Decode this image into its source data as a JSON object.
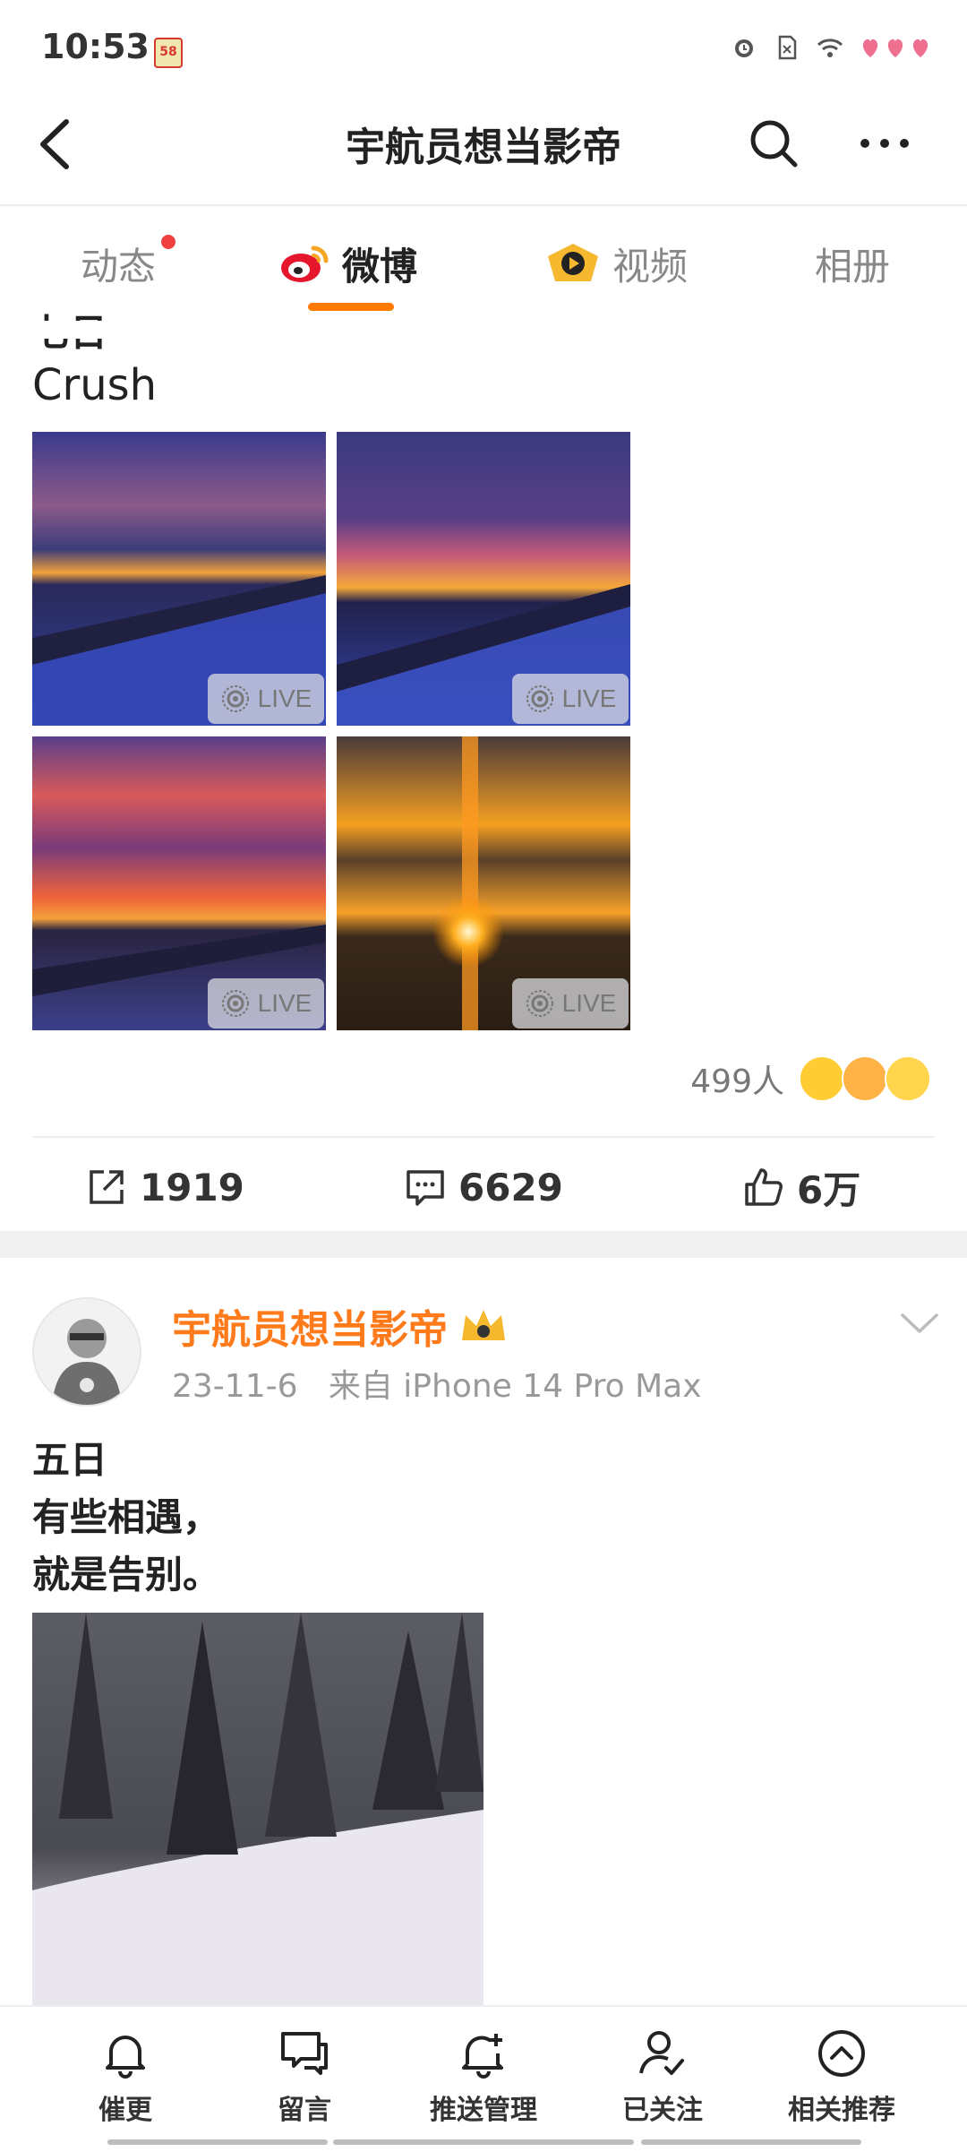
{
  "status": {
    "time": "10:53",
    "badge_text": "58",
    "icons": [
      "alarm-icon",
      "sim-icon",
      "wifi-icon",
      "hearts-icon"
    ]
  },
  "nav": {
    "title": "宇航员想当影帝",
    "back_icon": "back-icon",
    "search_icon": "search-icon",
    "more_icon": "more-icon"
  },
  "tabs": [
    {
      "label": "动态",
      "active": false,
      "has_dot": true
    },
    {
      "label": "微博",
      "active": true
    },
    {
      "label": "视频",
      "active": false
    },
    {
      "label": "相册",
      "active": false
    }
  ],
  "post1": {
    "partial_title": "七日",
    "text": "Crush",
    "photos": [
      {
        "label": "LIVE"
      },
      {
        "label": "LIVE"
      },
      {
        "label": "LIVE"
      },
      {
        "label": "LIVE"
      }
    ],
    "reaction_count": "499人",
    "actions": {
      "repost": "1919",
      "comment": "6629",
      "like": "6万"
    }
  },
  "post2": {
    "author": "宇航员想当影帝",
    "date": "23-11-6",
    "source": "来自 iPhone 14 Pro Max",
    "lines": [
      "五日",
      "有些相遇，",
      "就是告别。"
    ]
  },
  "bottom_bar": [
    {
      "label": "催更",
      "icon": "bell-icon"
    },
    {
      "label": "留言",
      "icon": "message-icon"
    },
    {
      "label": "推送管理",
      "icon": "bell-plus-icon"
    },
    {
      "label": "已关注",
      "icon": "user-check-icon"
    },
    {
      "label": "相关推荐",
      "icon": "chevron-up-circle-icon"
    }
  ],
  "colors": {
    "accent": "#ff7b00",
    "author": "#ff7a1a"
  }
}
